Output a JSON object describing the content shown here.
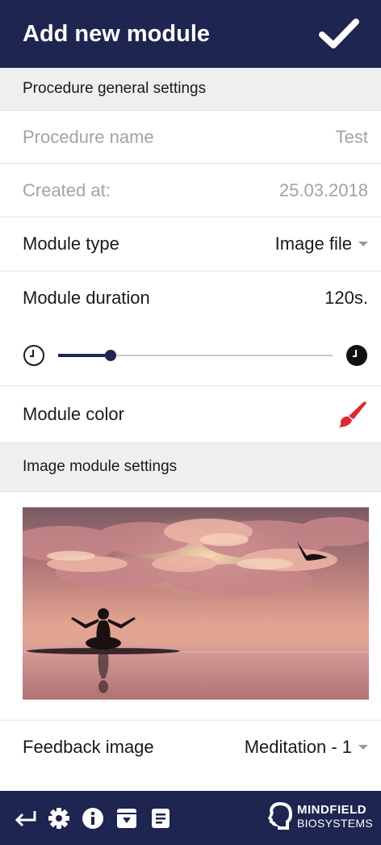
{
  "header": {
    "title": "Add new module"
  },
  "general": {
    "section_title": "Procedure general settings",
    "procedure_name_label": "Procedure name",
    "procedure_name_value": "Test",
    "created_label": "Created at:",
    "created_value": "25.03.2018",
    "module_type_label": "Module type",
    "module_type_value": "Image file",
    "duration_label": "Module duration",
    "duration_value": "120s.",
    "duration_slider_fraction": 0.19,
    "color_label": "Module color",
    "color_value": "#e0282e"
  },
  "image_settings": {
    "section_title": "Image module settings",
    "feedback_label": "Feedback image",
    "feedback_value": "Meditation - 1"
  },
  "bottom_bar": {
    "icons": [
      "back-arrow-icon",
      "gear-icon",
      "info-icon",
      "download-icon",
      "list-icon"
    ],
    "logo_top": "MINDFIELD",
    "logo_bottom": "BIOSYSTEMS"
  },
  "colors": {
    "primary": "#1d2550",
    "section_bg": "#efeff0",
    "accent_red": "#e0282e"
  }
}
